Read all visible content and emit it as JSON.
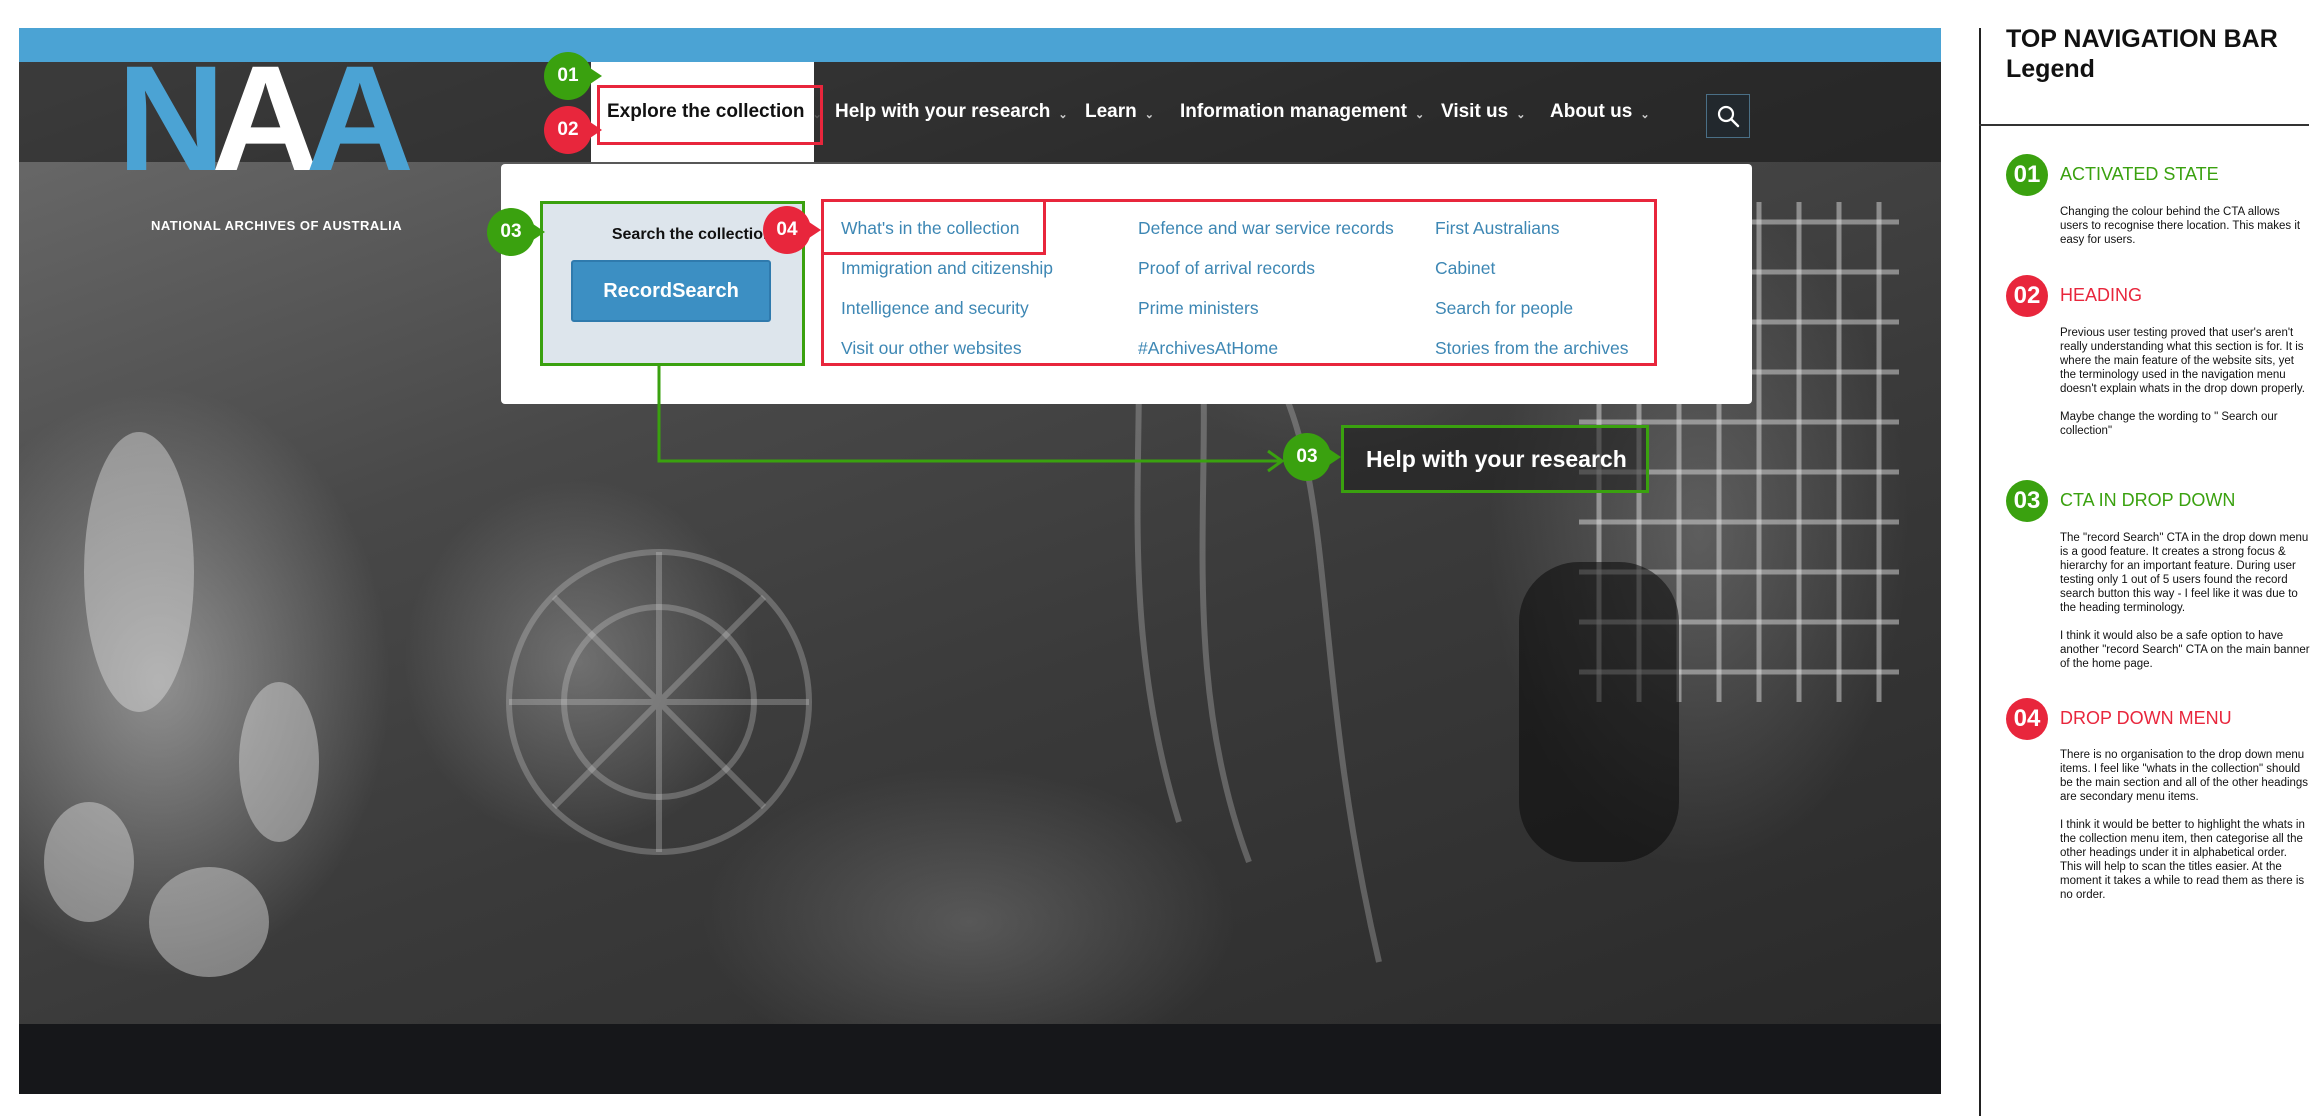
{
  "logo": {
    "letters_blue_1": "N",
    "letter_white": "A",
    "letters_blue_2": "A",
    "subtitle": "NATIONAL ARCHIVES OF AUSTRALIA"
  },
  "nav": {
    "items": [
      {
        "label": "Explore the collection",
        "active": true
      },
      {
        "label": "Help with your research"
      },
      {
        "label": "Learn"
      },
      {
        "label": "Information management"
      },
      {
        "label": "Visit us"
      },
      {
        "label": "About us"
      }
    ],
    "search_icon": "search-icon"
  },
  "dropdown": {
    "search_label": "Search the collection:",
    "record_search": "RecordSearch",
    "links": [
      "What's in the collection",
      "Immigration and citizenship",
      "Intelligence and security",
      "Visit our other websites",
      "Defence and war service records",
      "Proof of arrival records",
      "Prime ministers",
      "#ArchivesAtHome",
      "First Australians",
      "Cabinet",
      "Search for people",
      "Stories from the archives"
    ]
  },
  "callout": {
    "label": "Help with your research"
  },
  "badges": {
    "b01": "01",
    "b02": "02",
    "b03": "03",
    "b04": "04"
  },
  "legend": {
    "title_line1": "TOP NAVIGATION BAR",
    "title_line2": "Legend",
    "entries": [
      {
        "number": "01",
        "heading": "ACTIVATED STATE",
        "color": "green",
        "paragraphs": [
          "Changing the colour behind the CTA allows users to recognise there location. This makes it easy for users."
        ]
      },
      {
        "number": "02",
        "heading": "HEADING",
        "color": "red",
        "paragraphs": [
          "Previous user testing proved that user's aren't really understanding what this section is for. It is where the main feature of the website sits, yet the terminology used in the navigation menu doesn't explain whats in the drop down properly.",
          "Maybe change the wording to \" Search our collection\""
        ]
      },
      {
        "number": "03",
        "heading": "CTA IN DROP DOWN",
        "color": "green",
        "paragraphs": [
          "The \"record Search\" CTA in the drop down menu is a good feature. It creates a strong focus & hierarchy for an important feature. During user testing only 1 out of 5 users found the record search button this way - I feel like it was due to the heading terminology.",
          "I think it would also be a safe option to have another \"record Search\" CTA on the main banner of the home page."
        ]
      },
      {
        "number": "04",
        "heading": "DROP DOWN MENU",
        "color": "red",
        "paragraphs": [
          "There is no organisation to the drop down menu items. I feel like \"whats in the collection\" should be the main section and all of the other headings are secondary menu items.",
          "I think it would be better to highlight the whats in the collection menu item, then categorise all the other headings under it in alphabetical order. This will help to scan the titles easier. At the moment it takes a while to read them as there is no order."
        ]
      }
    ]
  },
  "colors": {
    "accent_blue": "#4ba3d4",
    "annotation_red": "#e8263c",
    "annotation_green": "#3aa10f",
    "link_blue": "#3d87b4"
  }
}
